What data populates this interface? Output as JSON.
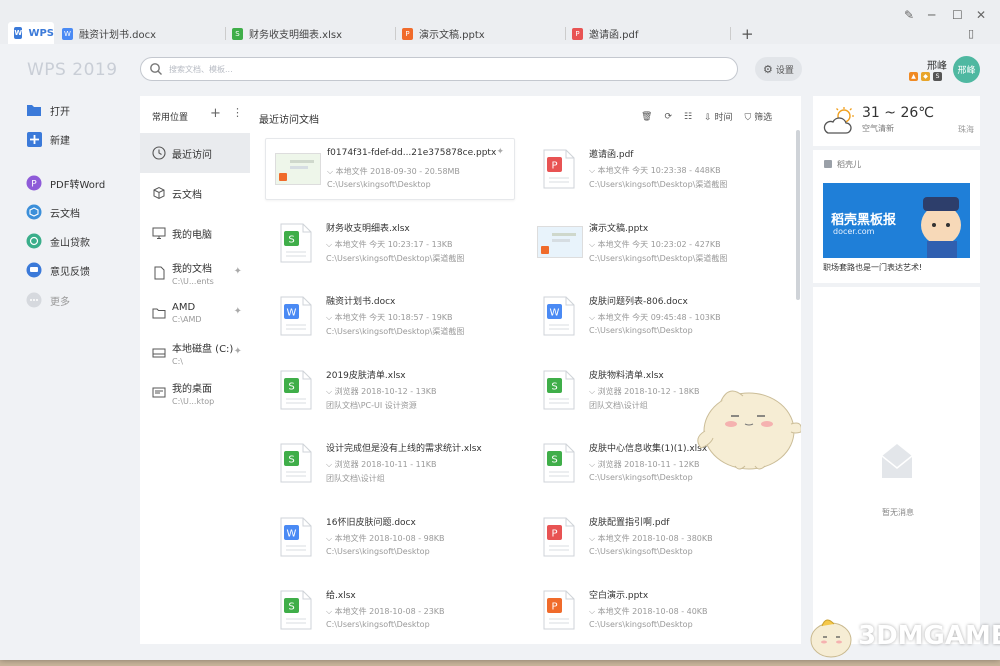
{
  "tabs": [
    {
      "label": "WPS",
      "type": "home"
    },
    {
      "label": "融资计划书.docx",
      "type": "docx"
    },
    {
      "label": "财务收支明细表.xlsx",
      "type": "xlsx"
    },
    {
      "label": "演示文稿.pptx",
      "type": "pptx"
    },
    {
      "label": "邀请函.pdf",
      "type": "pdf"
    }
  ],
  "new_tab_symbol": "+",
  "header": {
    "logo": "WPS 2019",
    "search_placeholder": "搜索文档、模板...",
    "settings_label": "设置",
    "user_name": "邢峰",
    "avatar_text": "邢峰"
  },
  "left_nav": [
    {
      "label": "打开",
      "icon": "folder-open-icon"
    },
    {
      "label": "新建",
      "icon": "plus-icon"
    },
    {
      "label": "PDF转Word",
      "icon": "pdf-convert-icon"
    },
    {
      "label": "云文档",
      "icon": "cloud-box-icon"
    },
    {
      "label": "金山贷款",
      "icon": "loan-icon"
    },
    {
      "label": "意见反馈",
      "icon": "feedback-icon"
    },
    {
      "label": "更多",
      "icon": "more-icon"
    }
  ],
  "locations": {
    "title": "常用位置",
    "items": [
      {
        "label": "最近访问",
        "sub": ""
      },
      {
        "label": "云文档",
        "sub": ""
      },
      {
        "label": "我的电脑",
        "sub": ""
      },
      {
        "label": "我的文档",
        "sub": "C:\\U...ents"
      },
      {
        "label": "AMD",
        "sub": "C:\\AMD"
      },
      {
        "label": "本地磁盘 (C:)",
        "sub": "C:\\"
      },
      {
        "label": "我的桌面",
        "sub": "C:\\U...ktop"
      }
    ]
  },
  "main": {
    "title": "最近访问文档",
    "tools": {
      "sort": "时间",
      "filter": "筛选"
    },
    "files": [
      {
        "name": "f0174f31-fdef-dd...21e375878ce.pptx",
        "meta": "本地文件  2018-09-30 - 20.58MB",
        "path": "C:\\Users\\kingsoft\\Desktop",
        "type": "thumb-pptx"
      },
      {
        "name": "邀请函.pdf",
        "meta": "本地文件  今天 10:23:38 - 448KB",
        "path": "C:\\Users\\kingsoft\\Desktop\\渠道截图",
        "type": "pdf"
      },
      {
        "name": "财务收支明细表.xlsx",
        "meta": "本地文件  今天 10:23:17 - 13KB",
        "path": "C:\\Users\\kingsoft\\Desktop\\渠道截图",
        "type": "xlsx"
      },
      {
        "name": "演示文稿.pptx",
        "meta": "本地文件  今天 10:23:02 - 427KB",
        "path": "C:\\Users\\kingsoft\\Desktop\\渠道截图",
        "type": "thumb-pptx2"
      },
      {
        "name": "融资计划书.docx",
        "meta": "本地文件  今天 10:18:57 - 19KB",
        "path": "C:\\Users\\kingsoft\\Desktop\\渠道截图",
        "type": "docx"
      },
      {
        "name": "皮肤问题列表-806.docx",
        "meta": "本地文件  今天 09:45:48 - 103KB",
        "path": "C:\\Users\\kingsoft\\Desktop",
        "type": "docx"
      },
      {
        "name": "2019皮肤清单.xlsx",
        "meta": "浏览器  2018-10-12 - 13KB",
        "path": "团队文档\\PC-UI 设计资源",
        "type": "xlsx"
      },
      {
        "name": "皮肤物料清单.xlsx",
        "meta": "浏览器  2018-10-12 - 18KB",
        "path": "团队文档\\设计组",
        "type": "xlsx"
      },
      {
        "name": "设计完成但是没有上线的需求统计.xlsx",
        "meta": "浏览器  2018-10-11 - 11KB",
        "path": "团队文档\\设计组",
        "type": "xlsx"
      },
      {
        "name": "皮肤中心信息收集(1)(1).xlsx",
        "meta": "浏览器  2018-10-11 - 12KB",
        "path": "C:\\Users\\kingsoft\\Desktop",
        "type": "xlsx"
      },
      {
        "name": "16怀旧皮肤问题.docx",
        "meta": "本地文件  2018-10-08 - 98KB",
        "path": "C:\\Users\\kingsoft\\Desktop",
        "type": "docx"
      },
      {
        "name": "皮肤配置指引啊.pdf",
        "meta": "本地文件  2018-10-08 - 380KB",
        "path": "C:\\Users\\kingsoft\\Desktop",
        "type": "pdf"
      },
      {
        "name": "给.xlsx",
        "meta": "本地文件  2018-10-08 - 23KB",
        "path": "C:\\Users\\kingsoft\\Desktop",
        "type": "xlsx"
      },
      {
        "name": "空白演示.pptx",
        "meta": "本地文件  2018-10-08 - 40KB",
        "path": "C:\\Users\\kingsoft\\Desktop",
        "type": "pptx"
      }
    ]
  },
  "weather": {
    "temp": "31 ~ 26℃",
    "desc": "空气清新",
    "city": "珠海"
  },
  "docer": {
    "label": "稻壳儿",
    "banner_title": "稻壳黑板报",
    "banner_url": "docer.com",
    "caption": "职场套路也是一门表达艺术!"
  },
  "messages": {
    "empty": "暂无消息"
  },
  "watermark": "3DMGAME",
  "colors": {
    "docx": "#4a8af4",
    "xlsx": "#3fae49",
    "pptx": "#f06b2b",
    "pdf": "#e85353",
    "accent": "#3b7ad9",
    "avatar": "#4fb8a1"
  }
}
